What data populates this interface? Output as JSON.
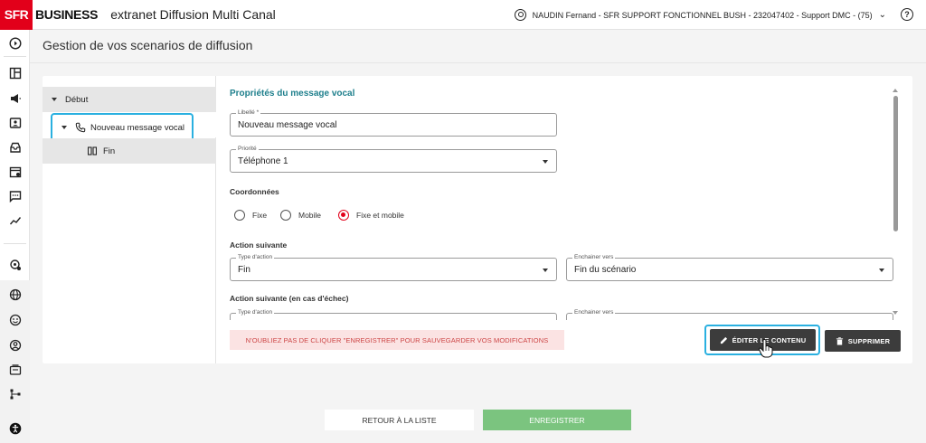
{
  "header": {
    "logo_sfr": "SFR",
    "logo_business": "BUSINESS",
    "app_title": "extranet Diffusion Multi Canal",
    "user": "NAUDIN Fernand - SFR SUPPORT FONCTIONNEL BUSH - 232047402 - Support DMC - (75)",
    "help": "?"
  },
  "page": {
    "title": "Gestion de vos scenarios de diffusion"
  },
  "tree": {
    "root": "Début",
    "node": "Nouveau message vocal",
    "end": "Fin"
  },
  "form": {
    "section_title": "Propriétés du message vocal",
    "libelle": {
      "label": "Libellé *",
      "value": "Nouveau message vocal"
    },
    "priorite": {
      "label": "Priorité",
      "value": "Téléphone 1"
    },
    "coordonnees": {
      "label": "Coordonnées",
      "options": [
        "Fixe",
        "Mobile",
        "Fixe et mobile"
      ],
      "selected": "Fixe et mobile"
    },
    "action_suivante": {
      "label": "Action suivante",
      "type_label": "Type d'action",
      "type_value": "Fin",
      "enchainer_label": "Enchainer vers",
      "enchainer_value": "Fin du scénario"
    },
    "action_echec": {
      "label": "Action suivante (en cas d'échec)",
      "type_label": "Type d'action",
      "enchainer_label": "Enchainer vers"
    }
  },
  "card_actions": {
    "warning": "N'OUBLIEZ PAS DE CLIQUER \"ENREGISTRER\" POUR SAUVEGARDER VOS MODIFICATIONS",
    "edit_label": "ÉDITER LE CONTENU",
    "delete_label": "SUPPRIMER"
  },
  "footer": {
    "back_label": "RETOUR À LA LISTE",
    "save_label": "ENREGISTRER"
  },
  "colors": {
    "brand_red": "#e2001a",
    "section_teal": "#1e7f8c",
    "highlight_blue": "#2ab0e0",
    "save_green": "#7bc47f",
    "dark_button": "#3c3c3c"
  },
  "icons": [
    "play-circle-icon",
    "layout-icon",
    "megaphone-icon",
    "contact-card-icon",
    "inbox-icon",
    "calendar-icon",
    "message-icon",
    "trend-icon",
    "settings-icon",
    "globe-icon",
    "face-icon",
    "user-circle-icon",
    "folder-icon",
    "hierarchy-icon",
    "accessibility-icon"
  ]
}
